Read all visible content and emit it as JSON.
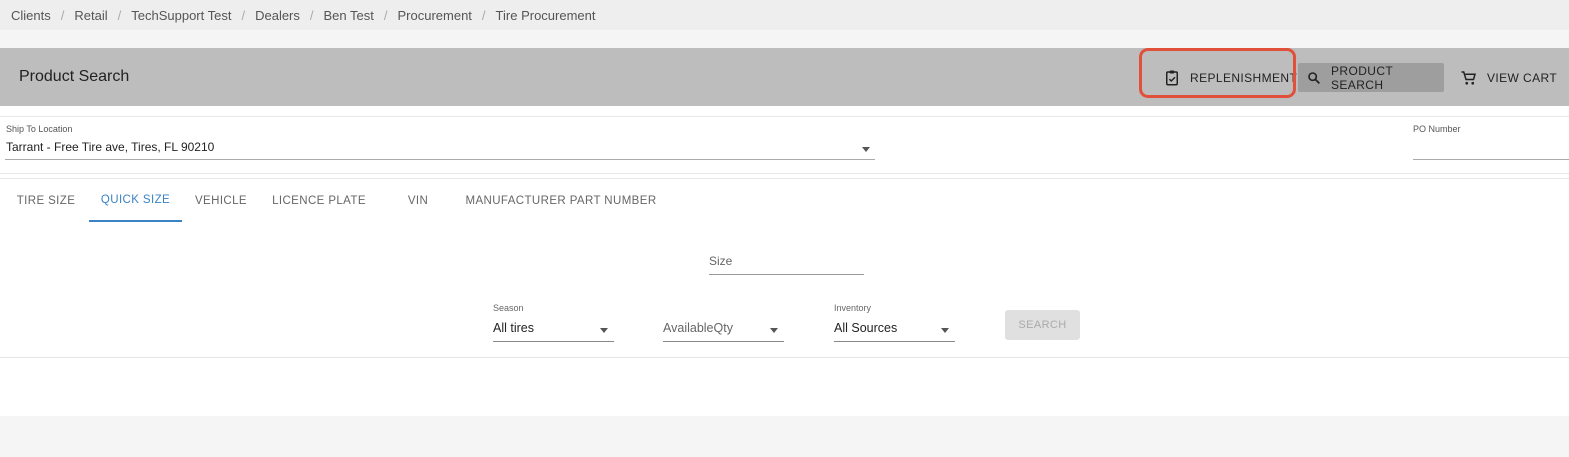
{
  "breadcrumb": [
    "Clients",
    "Retail",
    "TechSupport Test",
    "Dealers",
    "Ben Test",
    "Procurement",
    "Tire Procurement"
  ],
  "header": {
    "title": "Product Search",
    "replenishment_label": "REPLENISHMENT",
    "product_search_label": "PRODUCT SEARCH",
    "view_cart_label": "VIEW CART"
  },
  "location": {
    "ship_to_label": "Ship To Location",
    "ship_to_value": "Tarrant - Free Tire ave, Tires, FL 90210",
    "po_label": "PO Number",
    "po_value": ""
  },
  "tabs": [
    {
      "label": "TIRE SIZE",
      "active": false
    },
    {
      "label": "QUICK SIZE",
      "active": true
    },
    {
      "label": "VEHICLE",
      "active": false
    },
    {
      "label": "LICENCE PLATE",
      "active": false
    },
    {
      "label": "VIN",
      "active": false
    },
    {
      "label": "MANUFACTURER PART NUMBER",
      "active": false
    }
  ],
  "form": {
    "size_placeholder": "Size",
    "season_label": "Season",
    "season_value": "All tires",
    "availability_value": "AvailableQty",
    "inventory_label": "Inventory",
    "inventory_value": "All Sources",
    "search_label": "SEARCH"
  },
  "colors": {
    "header_bg": "#bdbdbd",
    "active_tab": "#3b82c4",
    "highlight": "#e0503a"
  }
}
